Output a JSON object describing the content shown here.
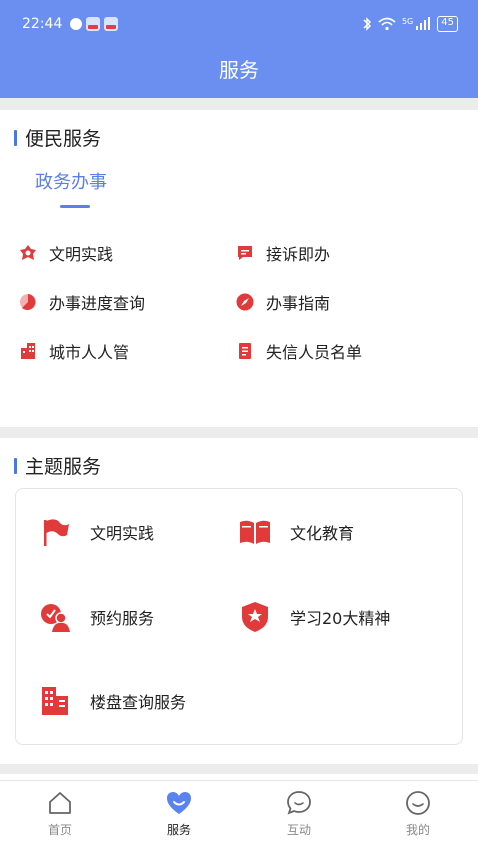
{
  "status": {
    "time": "22:44",
    "network": "5G",
    "battery": "45"
  },
  "header": {
    "title": "服务"
  },
  "section1": {
    "title": "便民服务",
    "tab": "政务办事",
    "items": [
      {
        "label": "文明实践",
        "icon": "flower-icon"
      },
      {
        "label": "接诉即办",
        "icon": "message-icon"
      },
      {
        "label": "办事进度查询",
        "icon": "pie-progress-icon"
      },
      {
        "label": "办事指南",
        "icon": "compass-icon"
      },
      {
        "label": "城市人人管",
        "icon": "building-icon"
      },
      {
        "label": "失信人员名单",
        "icon": "list-doc-icon"
      }
    ]
  },
  "section2": {
    "title": "主题服务",
    "items": [
      {
        "label": "文明实践",
        "icon": "flag-icon"
      },
      {
        "label": "文化教育",
        "icon": "book-icon"
      },
      {
        "label": "预约服务",
        "icon": "appointment-icon"
      },
      {
        "label": "学习20大精神",
        "icon": "badge-star-icon"
      },
      {
        "label": "楼盘查询服务",
        "icon": "building-icon"
      }
    ]
  },
  "tabbar": {
    "items": [
      {
        "label": "首页",
        "icon": "home-icon"
      },
      {
        "label": "服务",
        "icon": "heart-icon",
        "active": true
      },
      {
        "label": "互动",
        "icon": "chat-icon"
      },
      {
        "label": "我的",
        "icon": "smile-icon"
      }
    ]
  },
  "colors": {
    "primary": "#6a8ff0",
    "accent": "#e03a3a",
    "tab_active": "#5a7fe6"
  }
}
